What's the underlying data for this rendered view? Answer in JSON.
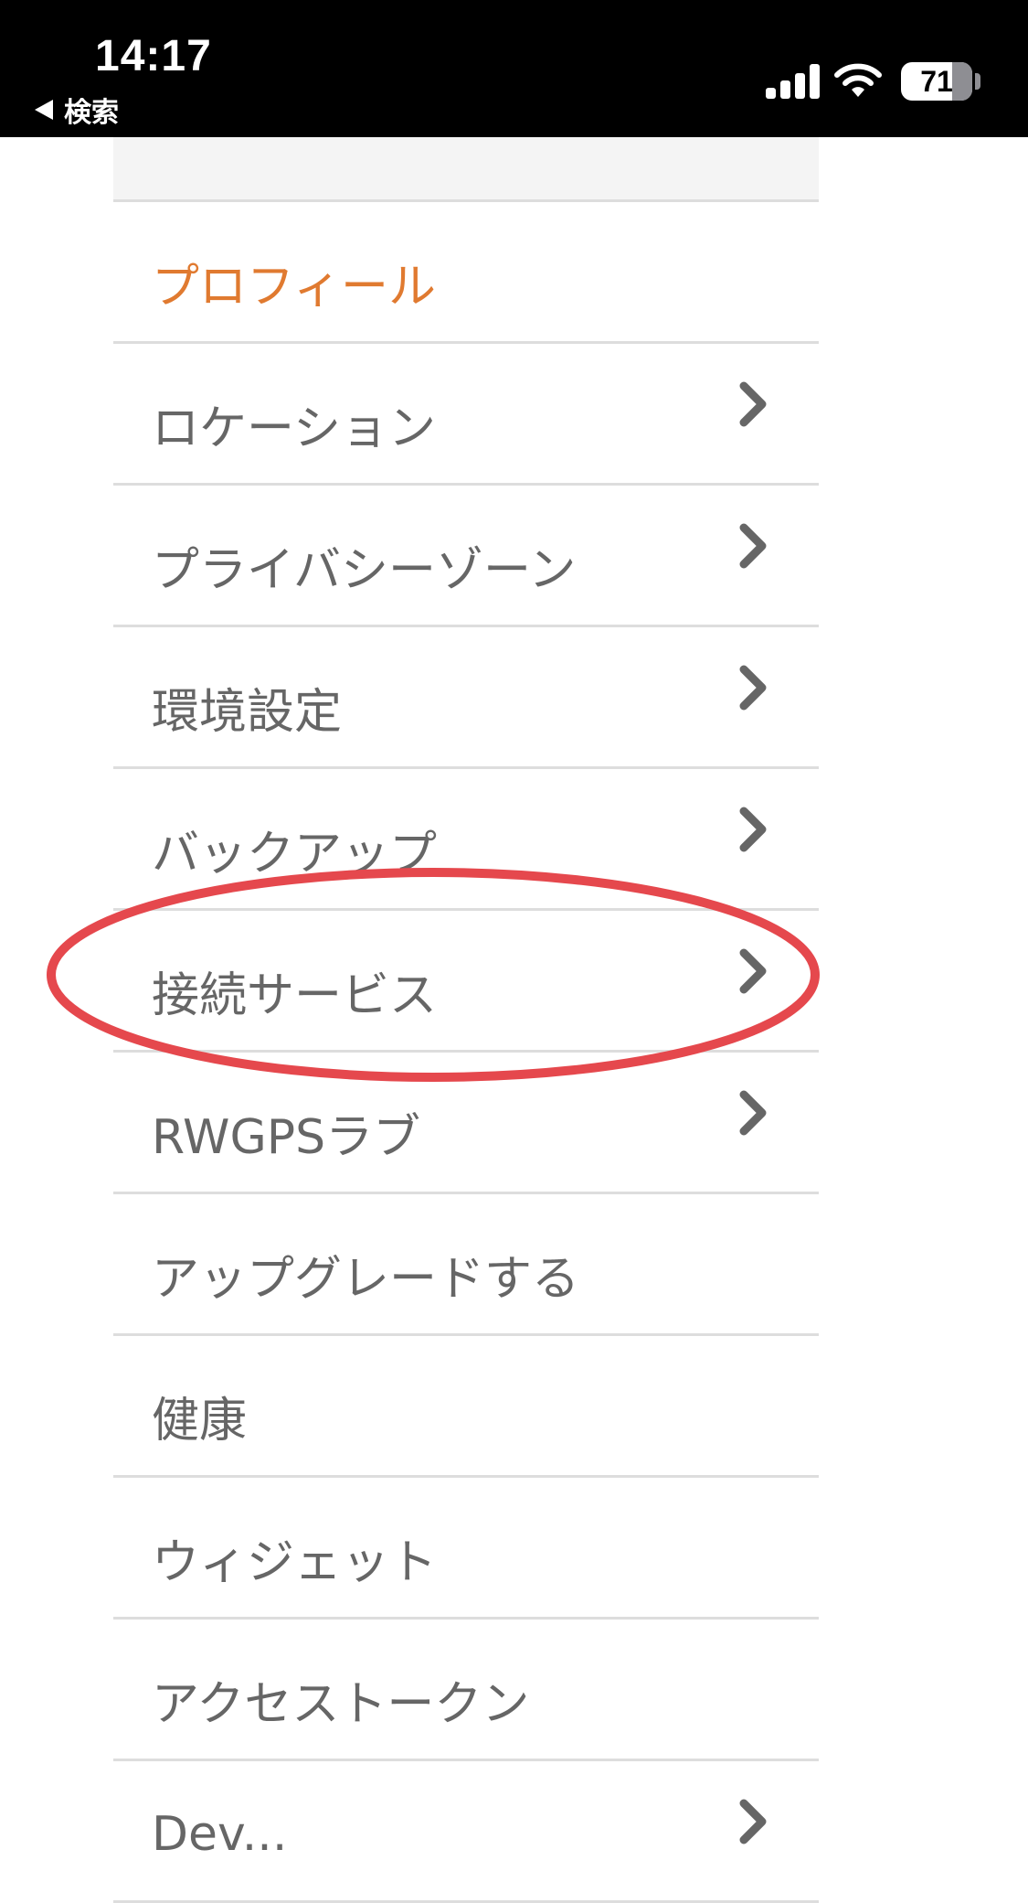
{
  "status_bar": {
    "time": "14:17",
    "back_label": "検索",
    "battery_level": "71"
  },
  "menu": {
    "items": [
      {
        "label": "プロフィール",
        "active": true,
        "chevron": false
      },
      {
        "label": "ロケーション",
        "active": false,
        "chevron": true
      },
      {
        "label": "プライバシーゾーン",
        "active": false,
        "chevron": true
      },
      {
        "label": "環境設定",
        "active": false,
        "chevron": true
      },
      {
        "label": "バックアップ",
        "active": false,
        "chevron": true
      },
      {
        "label": "接続サービス",
        "active": false,
        "chevron": true,
        "highlighted": true
      },
      {
        "label": "RWGPSラブ",
        "active": false,
        "chevron": true
      },
      {
        "label": "アップグレードする",
        "active": false,
        "chevron": false
      },
      {
        "label": "健康",
        "active": false,
        "chevron": false
      },
      {
        "label": "ウィジェット",
        "active": false,
        "chevron": false
      },
      {
        "label": "アクセストークン",
        "active": false,
        "chevron": false
      },
      {
        "label": "Dev...",
        "active": false,
        "chevron": true
      }
    ]
  },
  "colors": {
    "active_item": "#e07a30",
    "item_text": "#666666",
    "annotation": "#e5484d"
  },
  "icons": {
    "chevron": "chevron-right-icon",
    "back": "back-arrow-icon"
  }
}
